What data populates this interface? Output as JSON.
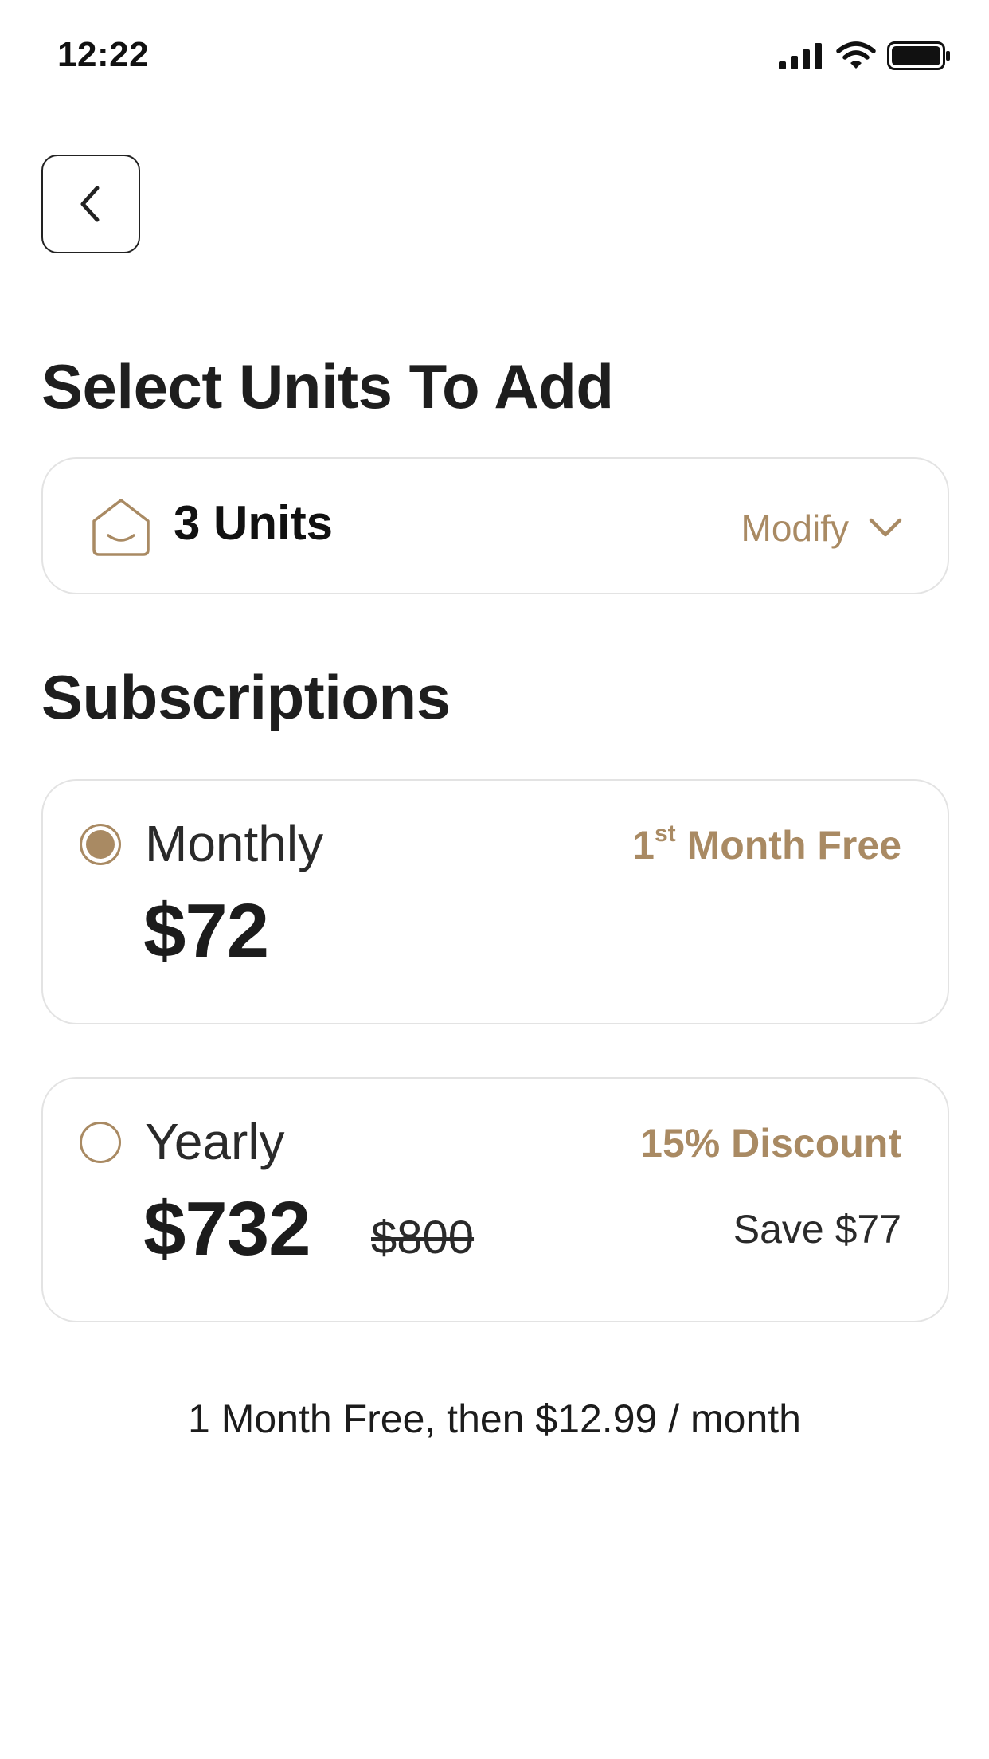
{
  "status_bar": {
    "time": "12:22"
  },
  "back_button": {
    "icon": "chevron-left-icon"
  },
  "units_section": {
    "title": "Select Units To Add",
    "selector": {
      "icon": "home-icon",
      "value": "3 Units",
      "modify_label": "Modify",
      "modify_icon": "chevron-down-icon"
    }
  },
  "subscriptions": {
    "title": "Subscriptions",
    "plans": [
      {
        "name": "Monthly",
        "price": "$72",
        "tag_number": "1",
        "tag_sup": "st",
        "tag_rest": " Month Free",
        "selected": true
      },
      {
        "name": "Yearly",
        "price": "$732",
        "old_price": "$800",
        "tag": "15% Discount",
        "savings": "Save $77",
        "selected": false
      }
    ]
  },
  "footnote": "1 Month Free, then $12.99 / month",
  "colors": {
    "accent": "#a98a63",
    "text": "#1c1c1c",
    "border": "#e3e3e3"
  }
}
